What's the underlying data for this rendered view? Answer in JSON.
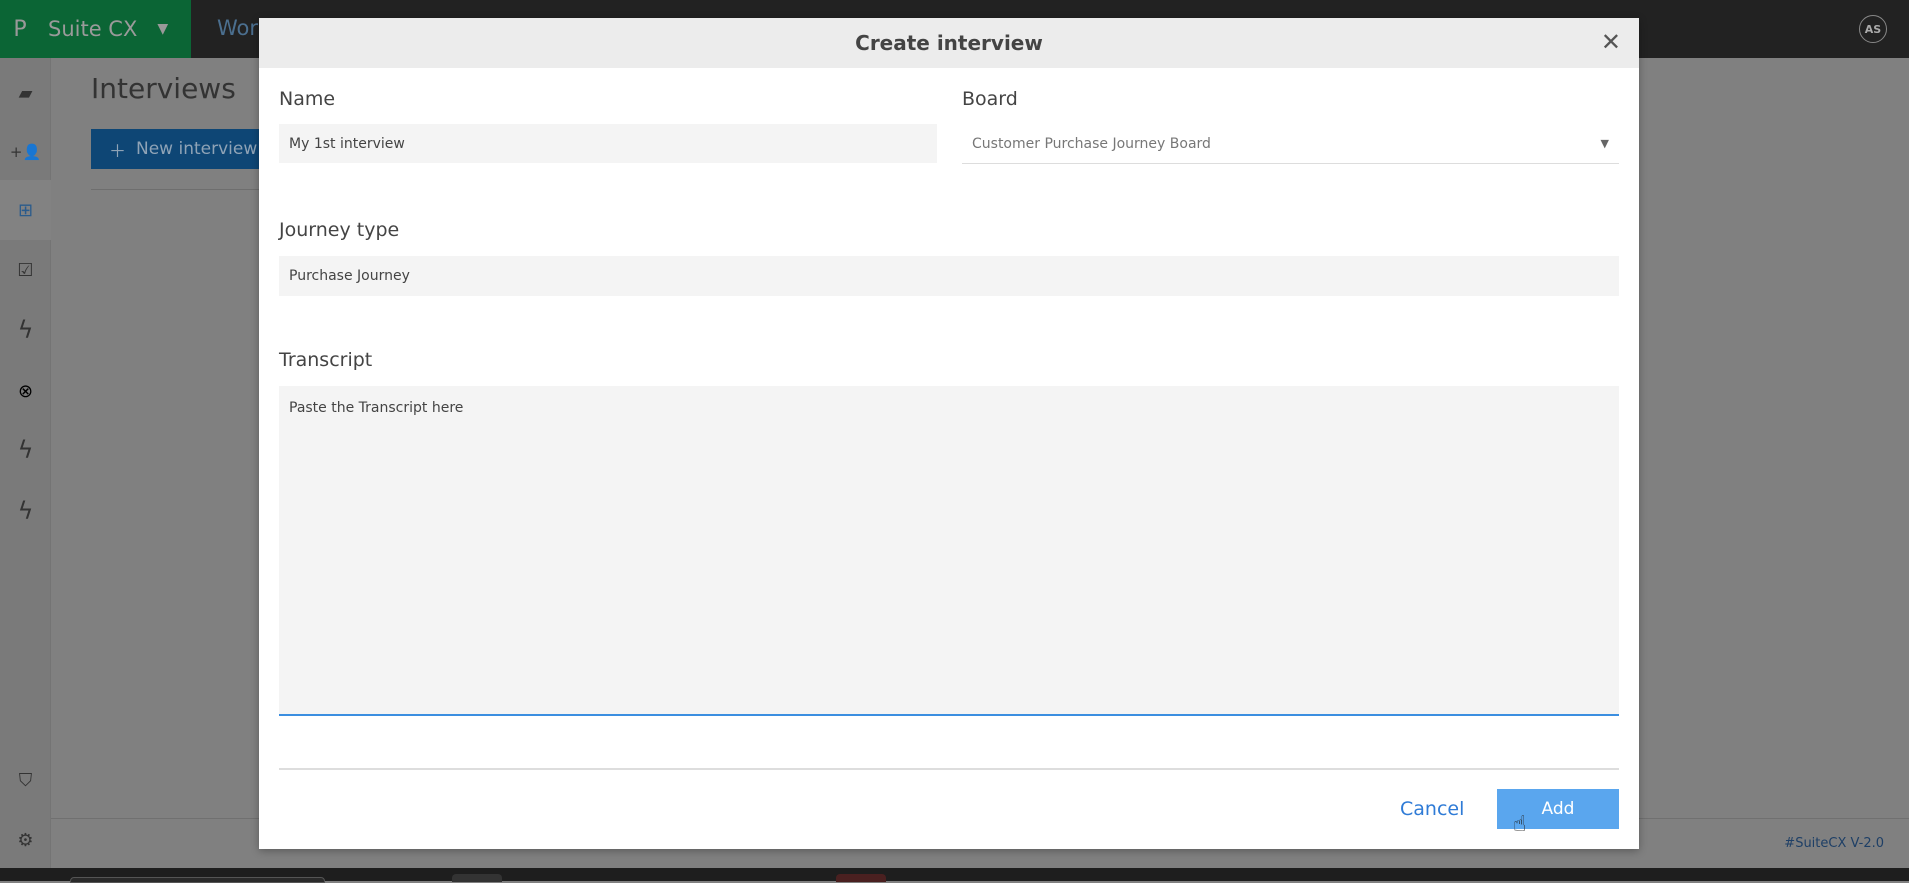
{
  "topbar": {
    "logo": "P",
    "app_name": "Suite CX",
    "workspace": "Wor",
    "avatar": "AS"
  },
  "sidebar": {
    "items": [
      {
        "icon": "folders-icon",
        "glyph": "▰"
      },
      {
        "icon": "add-user-icon",
        "glyph": "+👤"
      },
      {
        "icon": "journey-map-icon",
        "glyph": "⊞"
      },
      {
        "icon": "chart-icon",
        "glyph": "☑"
      },
      {
        "icon": "lightning-icon",
        "glyph": "ϟ"
      },
      {
        "icon": "target-icon",
        "glyph": "⊗"
      },
      {
        "icon": "lightning-icon",
        "glyph": "ϟ"
      },
      {
        "icon": "lightning-icon",
        "glyph": "ϟ"
      },
      {
        "icon": "shield-user-icon",
        "glyph": "⛉"
      },
      {
        "icon": "gear-icon",
        "glyph": "⚙"
      }
    ]
  },
  "main": {
    "title": "Interviews",
    "new_button": "New interview",
    "version": "#SuiteCX V-2.0"
  },
  "modal": {
    "title": "Create interview",
    "name_label": "Name",
    "name_value": "My 1st interview",
    "board_label": "Board",
    "board_value": "Customer Purchase Journey Board",
    "journey_label": "Journey type",
    "journey_value": "Purchase Journey",
    "transcript_label": "Transcript",
    "transcript_placeholder": "Paste the Transcript here",
    "cancel": "Cancel",
    "add": "Add"
  }
}
